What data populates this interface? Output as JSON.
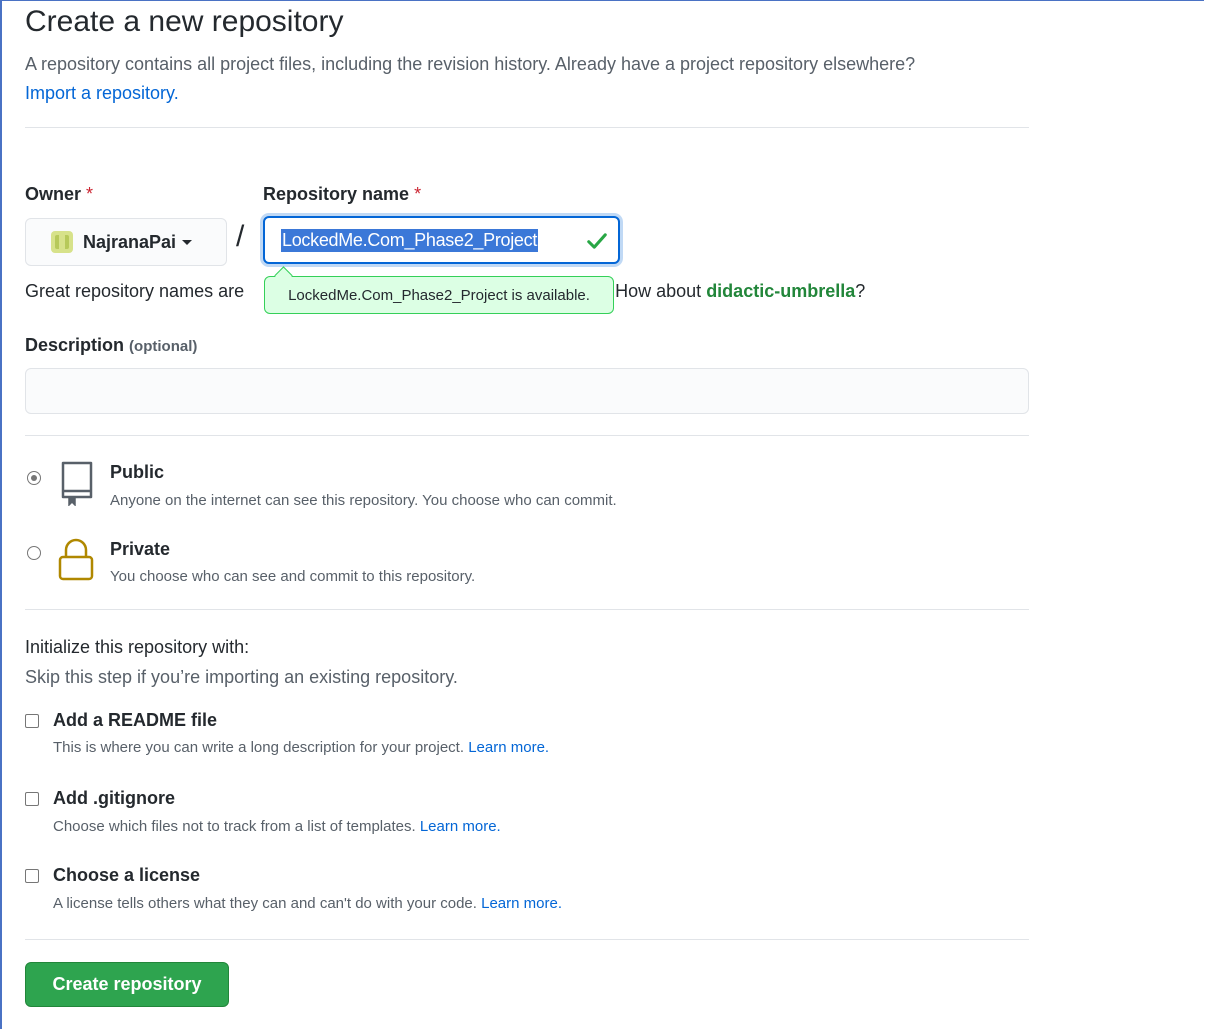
{
  "page": {
    "title": "Create a new repository",
    "subtitle": "A repository contains all project files, including the revision history. Already have a project repository elsewhere?",
    "import_link": "Import a repository."
  },
  "owner": {
    "label": "Owner",
    "required_mark": "*",
    "selected": "NajranaPai"
  },
  "separator": "/",
  "repo_name": {
    "label": "Repository name",
    "required_mark": "*",
    "value": "LockedMe.Com_Phase2_Project",
    "availability_tooltip": "LockedMe.Com_Phase2_Project is available."
  },
  "name_hint": {
    "prefix": "Great repository names are",
    "suffix": "? How about",
    "suggestion": "didactic-umbrella",
    "end": "?"
  },
  "description": {
    "label": "Description",
    "optional": "(optional)",
    "value": ""
  },
  "visibility": {
    "public": {
      "title": "Public",
      "desc": "Anyone on the internet can see this repository. You choose who can commit.",
      "checked": true
    },
    "private": {
      "title": "Private",
      "desc": "You choose who can see and commit to this repository.",
      "checked": false
    }
  },
  "initialize": {
    "heading": "Initialize this repository with:",
    "sub": "Skip this step if you’re importing an existing repository.",
    "readme": {
      "label": "Add a README file",
      "desc": "This is where you can write a long description for your project.",
      "link": "Learn more."
    },
    "gitignore": {
      "label": "Add .gitignore",
      "desc": "Choose which files not to track from a list of templates.",
      "link": "Learn more."
    },
    "license": {
      "label": "Choose a license",
      "desc": "A license tells others what they can and can't do with your code.",
      "link": "Learn more."
    }
  },
  "submit": {
    "label": "Create repository"
  },
  "colors": {
    "primary_button": "#2ea44f",
    "link": "#0366d6",
    "success": "#22863a",
    "required": "#cb2431",
    "tooltip_bg": "#dcffe4"
  },
  "icons": {
    "public": "repo-icon",
    "private": "lock-icon",
    "valid": "check-icon",
    "owner_menu": "caret-down-icon"
  }
}
